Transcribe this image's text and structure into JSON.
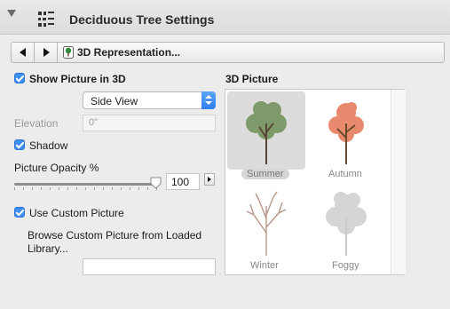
{
  "header": {
    "title": "Deciduous Tree Settings"
  },
  "nav": {
    "label": "3D Representation..."
  },
  "left": {
    "show_picture_label": "Show Picture in 3D",
    "view_select": "Side View",
    "elevation_label": "Elevation",
    "elevation_value": "0\"",
    "shadow_label": "Shadow",
    "opacity_label": "Picture Opacity %",
    "opacity_value": "100",
    "opacity_percent": 100,
    "custom_picture_label": "Use Custom Picture",
    "browse_label": "Browse Custom Picture from Loaded Library...",
    "browse_value": ""
  },
  "picture": {
    "title": "3D Picture",
    "items": [
      {
        "label": "Summer",
        "selected": true,
        "color": "#7f9a6a"
      },
      {
        "label": "Autumn",
        "selected": false,
        "color": "#e98a6e"
      },
      {
        "label": "Winter",
        "selected": false,
        "color": "#b89688"
      },
      {
        "label": "Foggy",
        "selected": false,
        "color": "#d5d5d5"
      }
    ]
  },
  "colors": {
    "accent": "#3d8ef0",
    "header_bg": "#dedede"
  }
}
